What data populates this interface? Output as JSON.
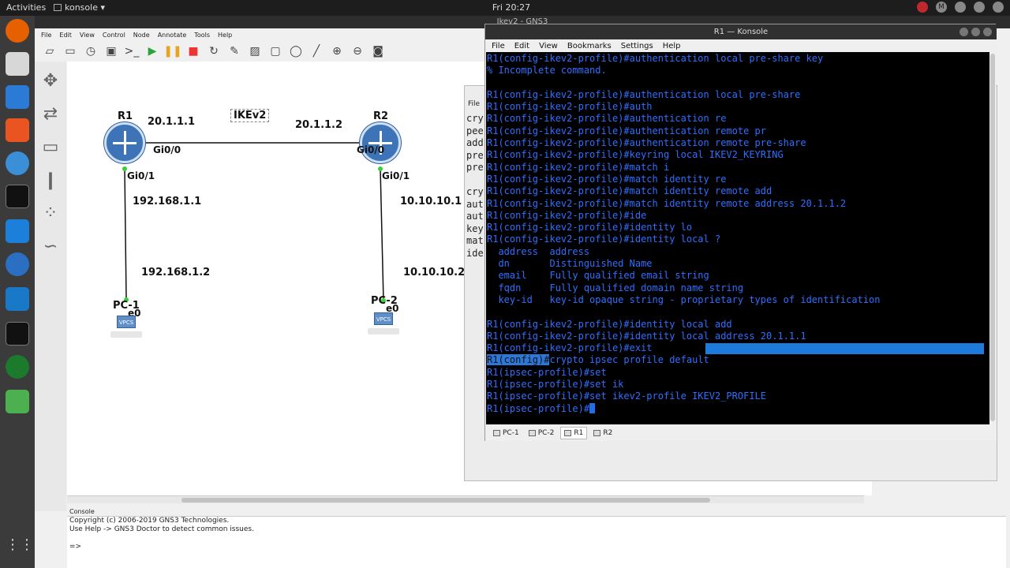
{
  "topbar": {
    "activities": "Activities",
    "app_name": "konsole ▾",
    "clock": "Fri 20:27",
    "tray_icons": [
      "record-icon",
      "user-icon",
      "network-icon",
      "volume-icon",
      "power-icon"
    ]
  },
  "gns": {
    "title": "Ikev2 - GNS3",
    "menu": [
      "File",
      "Edit",
      "View",
      "Control",
      "Node",
      "Annotate",
      "Tools",
      "Help"
    ],
    "toolbar": [
      "new-project-icon",
      "open-icon",
      "timer-icon",
      "snapshot-icon",
      "console-icon",
      "start-icon",
      "pause-icon",
      "stop-icon",
      "reload-icon",
      "edit-icon",
      "image-icon",
      "rectangle-icon",
      "ellipse-icon",
      "line-icon",
      "zoom-in-icon",
      "zoom-out-icon",
      "screenshot-icon"
    ],
    "topology": {
      "r1_label": "R1",
      "r2_label": "R2",
      "r1_gi00_ip": "20.1.1.1",
      "r2_gi00_ip": "20.1.1.2",
      "r1_gi00": "Gi0/0",
      "r2_gi00": "Gi0/0",
      "r1_gi01": "Gi0/1",
      "r2_gi01": "Gi0/1",
      "r1_lan_ip": "192.168.1.1",
      "pc1_ip": "192.168.1.2",
      "r2_lan_ip": "10.10.10.1",
      "pc2_ip": "10.10.10.2",
      "pc1_label": "PC-1",
      "pc2_label": "PC-2",
      "pc1_port": "e0",
      "pc2_port": "e0",
      "vpcs": "VPCS",
      "note": "IKEv2"
    },
    "console": {
      "title": "Console",
      "lines": [
        "Copyright (c) 2006-2019 GNS3 Technologies.",
        "Use Help -> GNS3 Doctor to detect common issues.",
        "",
        "=>"
      ]
    }
  },
  "konsole2": {
    "menu": "File",
    "lines": [
      "cry",
      "pee",
      "add",
      "pre",
      "pre",
      "",
      "cry",
      "aut",
      "aut",
      "key",
      "mat",
      "ide"
    ]
  },
  "konsole": {
    "title": "R1 — Konsole",
    "menu": [
      "File",
      "Edit",
      "View",
      "Bookmarks",
      "Settings",
      "Help"
    ],
    "lines": [
      "R1(config-ikev2-profile)#authentication local pre-share key",
      "% Incomplete command.",
      "",
      "R1(config-ikev2-profile)#authentication local pre-share",
      "R1(config-ikev2-profile)#auth",
      "R1(config-ikev2-profile)#authentication re",
      "R1(config-ikev2-profile)#authentication remote pr",
      "R1(config-ikev2-profile)#authentication remote pre-share",
      "R1(config-ikev2-profile)#keyring local IKEV2_KEYRING",
      "R1(config-ikev2-profile)#match i",
      "R1(config-ikev2-profile)#match identity re",
      "R1(config-ikev2-profile)#match identity remote add",
      "R1(config-ikev2-profile)#match identity remote address 20.1.1.2",
      "R1(config-ikev2-profile)#ide",
      "R1(config-ikev2-profile)#identity lo",
      "R1(config-ikev2-profile)#identity local ?",
      "  address  address",
      "  dn       Distinguished Name",
      "  email    Fully qualified email string",
      "  fqdn     Fully qualified domain name string",
      "  key-id   key-id opaque string - proprietary types of identification",
      "",
      "R1(config-ikev2-profile)#identity local add",
      "R1(config-ikev2-profile)#identity local address 20.1.1.1",
      "R1(config-ikev2-profile)#exit"
    ],
    "hl_prompt": "R1(config)#",
    "hl_rest": "crypto ipsec profile default",
    "tail_lines": [
      "R1(ipsec-profile)#set",
      "R1(ipsec-profile)#set ik",
      "R1(ipsec-profile)#set ikev2-profile IKEV2_PROFILE"
    ],
    "last_prompt": "R1(ipsec-profile)#",
    "tabs": [
      "PC-1",
      "PC-2",
      "R1",
      "R2"
    ],
    "active_tab": "R1"
  }
}
